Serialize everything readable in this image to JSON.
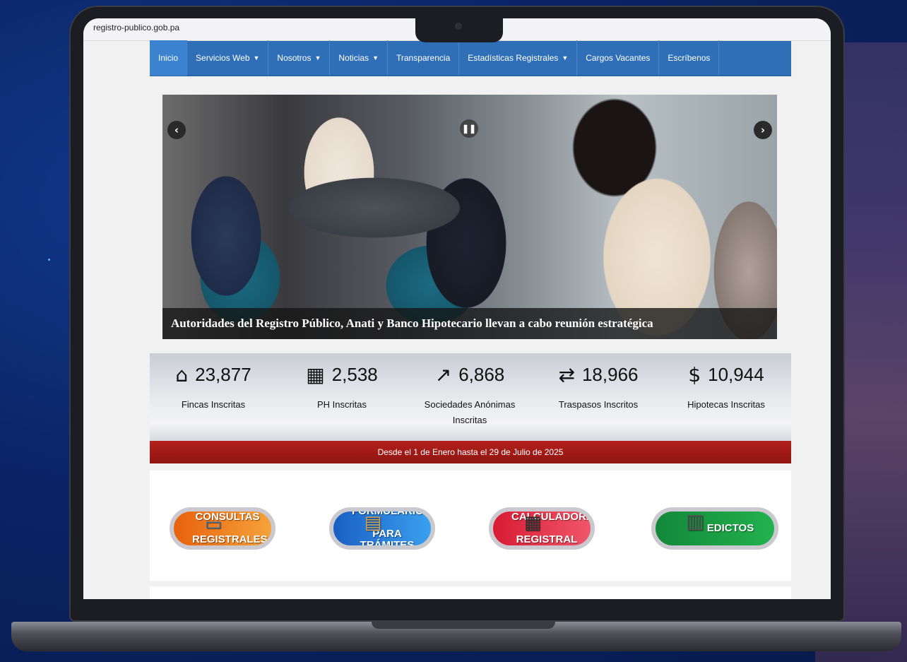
{
  "browser": {
    "url": "registro-publico.gob.pa"
  },
  "nav": {
    "items": [
      {
        "label": "Inicio",
        "dropdown": false,
        "active": true
      },
      {
        "label": "Servicios Web",
        "dropdown": true
      },
      {
        "label": "Nosotros",
        "dropdown": true
      },
      {
        "label": "Noticias",
        "dropdown": true
      },
      {
        "label": "Transparencia",
        "dropdown": false
      },
      {
        "label": "Estadísticas Registrales",
        "dropdown": true
      },
      {
        "label": "Cargos Vacantes",
        "dropdown": false
      },
      {
        "label": "Escríbenos",
        "dropdown": false
      }
    ]
  },
  "slider": {
    "caption": "Autoridades del Registro Público, Anati y Banco Hipotecario llevan a cabo reunión estratégica",
    "prev_icon": "chevron-left-icon",
    "next_icon": "chevron-right-icon",
    "pause_icon": "pause-icon"
  },
  "stats": {
    "items": [
      {
        "icon": "house-icon",
        "value": "23,877",
        "label": "Fincas Inscritas"
      },
      {
        "icon": "building-icon",
        "value": "2,538",
        "label": "PH Inscritas"
      },
      {
        "icon": "chart-growth-icon",
        "value": "6,868",
        "label": "Sociedades Anónimas Inscritas"
      },
      {
        "icon": "house-transfer-icon",
        "value": "18,966",
        "label": "Traspasos Inscritos"
      },
      {
        "icon": "mortgage-icon",
        "value": "10,944",
        "label": "Hipotecas Inscritas"
      }
    ],
    "period": "Desde el 1 de Enero hasta el 29 de Julio de 2025"
  },
  "quick_links": [
    {
      "line1": "CONSULTAS",
      "line2": "REGISTRALES",
      "icon": "computer-icon",
      "color": "#f07a1e"
    },
    {
      "line1": "FORMULARIOS",
      "line2": "PARA TRÁMITES",
      "icon": "clipboard-icon",
      "color": "#1e6fd6"
    },
    {
      "line1": "CALCULADORA",
      "line2": "REGISTRAL",
      "icon": "calculator-icon",
      "color": "#e2283b"
    },
    {
      "line1": "EDICTOS",
      "line2": "",
      "icon": "document-icon",
      "color": "#16a34a"
    }
  ]
}
